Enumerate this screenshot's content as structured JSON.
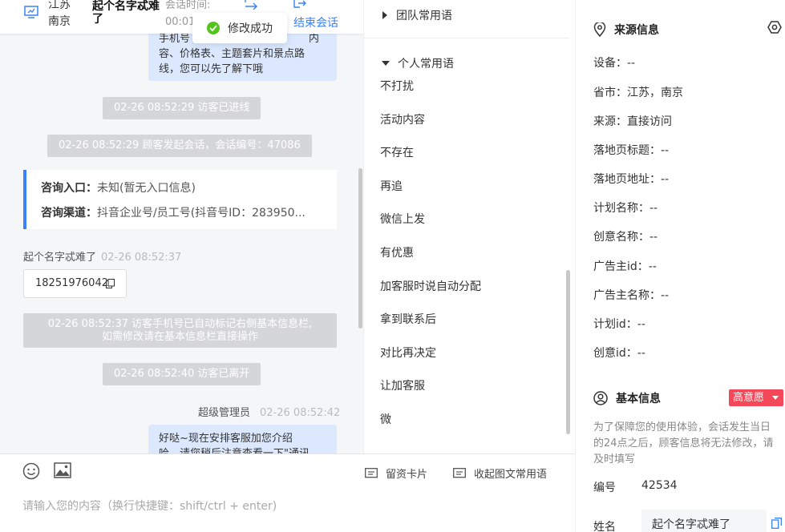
{
  "header": {
    "province": "江苏",
    "city": "南京",
    "visitor_name": "起个名字忒难了",
    "session_time_label": "会话时间:",
    "session_time_value": "00:01",
    "end_label": "结束会话",
    "toast": "修改成功"
  },
  "chat": {
    "top_bubble": [
      "手机号",
      "容、价格表、主题套片和景点路",
      "线，您可以先了解下哦"
    ],
    "top_bubble_suffix": "内",
    "sys_enter": "02-26 08:52:29 访客已进线",
    "sys_start": "02-26 08:52:29 顾客发起会话，会话编号：47086",
    "card": {
      "entry_label": "咨询入口：",
      "entry_value": "未知(暂无入口信息)",
      "channel_label": "咨询渠道：",
      "channel_value": "抖音企业号/员工号(抖音号ID：283950..."
    },
    "visitor_name": "起个名字忒难了",
    "visitor_time": "02-26 08:52:37",
    "phone": "18251976042",
    "sys_phone_note_1": "02-26 08:52:37 访客手机号已自动标记右侧基本信息栏,",
    "sys_phone_note_2": "如需修改请在基本信息栏直接操作",
    "sys_leave": "02-26 08:52:40 访客已离开",
    "agent_name": "超级管理员",
    "agent_time": "02-26 08:52:42",
    "agent_bubble": [
      "好哒~现在安排客服加您介绍",
      "哈，请您稍后注意查看一下\"通讯"
    ]
  },
  "input": {
    "placeholder": "请输入您的内容（换行快捷键：shift/ctrl + enter)",
    "card_button": "留资卡片",
    "collapse_button": "收起图文常用语"
  },
  "phrases": {
    "team_group": "团队常用语",
    "personal_group": "个人常用语",
    "items": [
      "不打扰",
      "活动内容",
      "不存在",
      "再追",
      "微信上发",
      "有优惠",
      "加客服时说自动分配",
      "拿到联系后",
      "对比再决定",
      "让加客服",
      "微"
    ]
  },
  "info": {
    "source_title": "来源信息",
    "source_rows": [
      "设备：--",
      "省市：江苏，南京",
      "来源：直接访问",
      "落地页标题：--",
      "落地页地址：--",
      "计划名称：--",
      "创意名称：--",
      "广告主id：--",
      "广告主名称：--",
      "计划id：--",
      "创意id：--"
    ],
    "basic_title": "基本信息",
    "intent_label": "高意愿",
    "note": "为了保障您的使用体验，会话发生当日的24点之后，顾客信息将无法修改，请及时填写",
    "id_label": "编号",
    "id_value": "42534",
    "name_label": "姓名",
    "name_value": "起个名字忒难了"
  },
  "colors": {
    "accent": "#3b82f6",
    "success": "#52c41a",
    "intent_badge": "#f5475a",
    "bubble": "#dbe8fd"
  }
}
